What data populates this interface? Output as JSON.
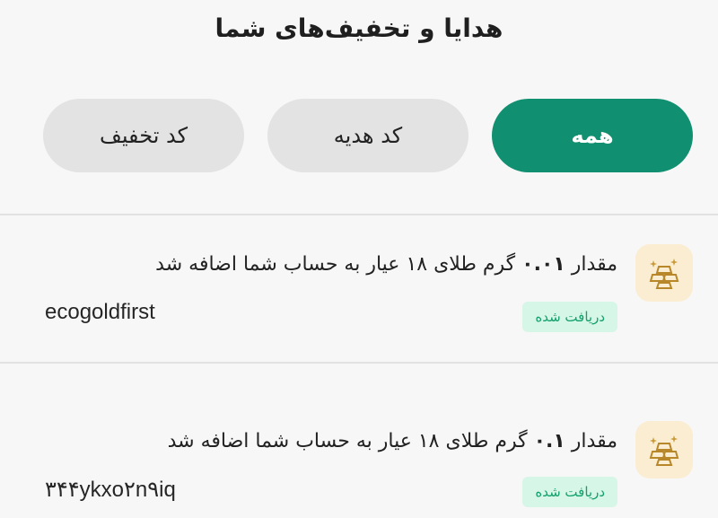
{
  "header": {
    "title": "هدایا و تخفیف‌های شما"
  },
  "tabs": [
    {
      "label": "همه",
      "active": true
    },
    {
      "label": "کد هدیه",
      "active": false
    },
    {
      "label": "کد تخفیف",
      "active": false
    }
  ],
  "items": [
    {
      "icon": "gold-bars-icon",
      "text_before": "مقدار",
      "amount": "۰.۰۱",
      "text_after": "گرم طلای ۱۸ عیار به حساب شما اضافه شد",
      "code": "ecogoldfirst",
      "status": "دریافت شده"
    },
    {
      "icon": "gold-bars-icon",
      "text_before": "مقدار",
      "amount": "۰.۱",
      "text_after": "گرم طلای ۱۸ عیار به حساب شما اضافه شد",
      "code": "۳۴۴ykxo۲n۹iq",
      "status": "دریافت شده"
    }
  ],
  "colors": {
    "accent": "#119071",
    "tab_inactive": "#e3e3e3",
    "badge_bg": "#d6f6e8",
    "badge_text": "#13a06c",
    "icon_bg": "#fbedd2"
  }
}
